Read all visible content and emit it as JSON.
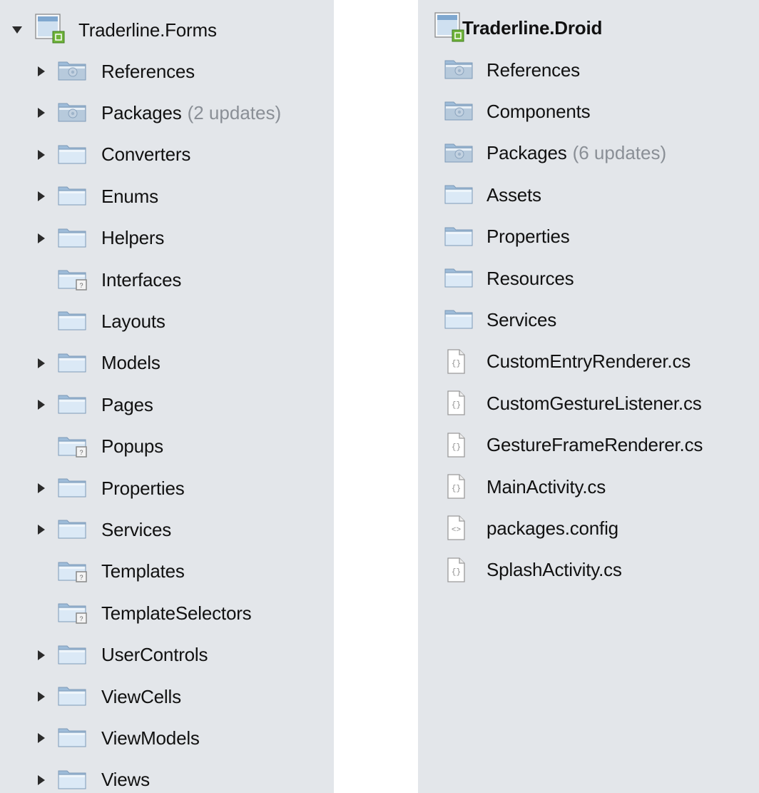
{
  "left_panel": {
    "project": {
      "label": "Traderline.Forms",
      "expanded": true
    },
    "items": [
      {
        "label": "References",
        "note": "",
        "icon": "references-folder-icon",
        "has_arrow": true
      },
      {
        "label": "Packages",
        "note": "(2 updates)",
        "icon": "packages-folder-icon",
        "has_arrow": true
      },
      {
        "label": "Converters",
        "note": "",
        "icon": "folder-icon",
        "has_arrow": true
      },
      {
        "label": "Enums",
        "note": "",
        "icon": "folder-icon",
        "has_arrow": true
      },
      {
        "label": "Helpers",
        "note": "",
        "icon": "folder-icon",
        "has_arrow": true
      },
      {
        "label": "Interfaces",
        "note": "",
        "icon": "unlinked-folder-icon",
        "has_arrow": false
      },
      {
        "label": "Layouts",
        "note": "",
        "icon": "folder-icon",
        "has_arrow": false
      },
      {
        "label": "Models",
        "note": "",
        "icon": "folder-icon",
        "has_arrow": true
      },
      {
        "label": "Pages",
        "note": "",
        "icon": "folder-icon",
        "has_arrow": true
      },
      {
        "label": "Popups",
        "note": "",
        "icon": "unlinked-folder-icon",
        "has_arrow": false
      },
      {
        "label": "Properties",
        "note": "",
        "icon": "folder-icon",
        "has_arrow": true
      },
      {
        "label": "Services",
        "note": "",
        "icon": "folder-icon",
        "has_arrow": true
      },
      {
        "label": "Templates",
        "note": "",
        "icon": "unlinked-folder-icon",
        "has_arrow": false
      },
      {
        "label": "TemplateSelectors",
        "note": "",
        "icon": "unlinked-folder-icon",
        "has_arrow": false
      },
      {
        "label": "UserControls",
        "note": "",
        "icon": "folder-icon",
        "has_arrow": true
      },
      {
        "label": "ViewCells",
        "note": "",
        "icon": "folder-icon",
        "has_arrow": true
      },
      {
        "label": "ViewModels",
        "note": "",
        "icon": "folder-icon",
        "has_arrow": true
      },
      {
        "label": "Views",
        "note": "",
        "icon": "folder-icon",
        "has_arrow": true
      }
    ]
  },
  "right_panel": {
    "project": {
      "label": "Traderline.Droid"
    },
    "items": [
      {
        "label": "References",
        "note": "",
        "icon": "references-folder-icon"
      },
      {
        "label": "Components",
        "note": "",
        "icon": "components-folder-icon"
      },
      {
        "label": "Packages",
        "note": "(6 updates)",
        "icon": "packages-folder-icon"
      },
      {
        "label": "Assets",
        "note": "",
        "icon": "folder-icon"
      },
      {
        "label": "Properties",
        "note": "",
        "icon": "folder-icon"
      },
      {
        "label": "Resources",
        "note": "",
        "icon": "folder-icon"
      },
      {
        "label": "Services",
        "note": "",
        "icon": "folder-icon"
      },
      {
        "label": "CustomEntryRenderer.cs",
        "note": "",
        "icon": "csharp-file-icon"
      },
      {
        "label": "CustomGestureListener.cs",
        "note": "",
        "icon": "csharp-file-icon"
      },
      {
        "label": "GestureFrameRenderer.cs",
        "note": "",
        "icon": "csharp-file-icon"
      },
      {
        "label": "MainActivity.cs",
        "note": "",
        "icon": "csharp-file-icon"
      },
      {
        "label": "packages.config",
        "note": "",
        "icon": "config-file-icon"
      },
      {
        "label": "SplashActivity.cs",
        "note": "",
        "icon": "csharp-file-icon"
      }
    ]
  },
  "colors": {
    "panel_bg": "#e3e6ea",
    "folder_light": "#dbe9f6",
    "folder_dark": "#9ebcd9",
    "folder_border": "#7d9ab8",
    "note_gray": "#8a8f96",
    "project_badge_green": "#6fb33a"
  }
}
